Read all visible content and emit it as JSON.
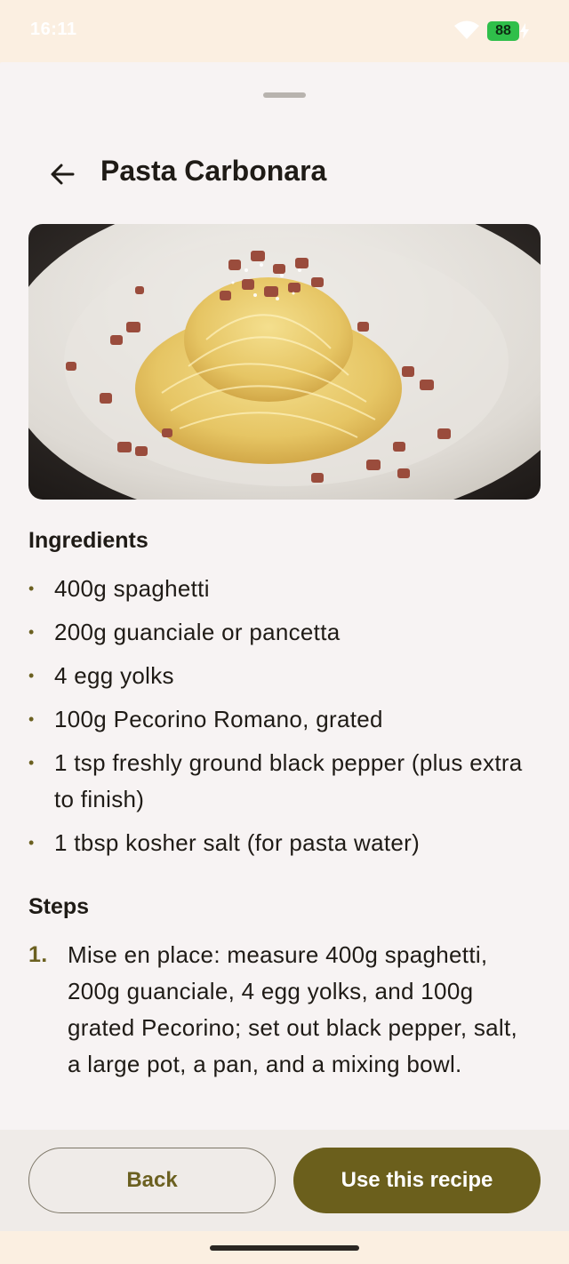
{
  "status_bar": {
    "time": "16:11",
    "battery": "88",
    "icons": [
      "wifi-icon",
      "battery-icon",
      "charging-bolt-icon"
    ]
  },
  "header": {
    "back_icon": "arrow-left-icon",
    "title": "Pasta Carbonara"
  },
  "hero_image": {
    "subject": "spaghetti carbonara on a white plate"
  },
  "ingredients": {
    "title": "Ingredients",
    "bullet": "•",
    "items": [
      "400g spaghetti",
      "200g guanciale or pancetta",
      "4 egg yolks",
      "100g Pecorino Romano, grated",
      "1 tsp freshly ground black pepper (plus extra to finish)",
      "1 tbsp kosher salt (for pasta water)"
    ]
  },
  "steps": {
    "title": "Steps",
    "items": [
      {
        "number": "1.",
        "text": "Mise en place: measure 400g spaghetti, 200g guanciale, 4 egg yolks, and 100g grated Pecorino; set out black pepper, salt, a large pot, a pan, and a mixing bowl."
      }
    ]
  },
  "actions": {
    "back_label": "Back",
    "use_label": "Use this recipe"
  },
  "colors": {
    "accent": "#6b5f1c",
    "sheet_background": "#f7f3f3",
    "status_background": "#fbefe1",
    "battery": "#2fbf4a"
  }
}
